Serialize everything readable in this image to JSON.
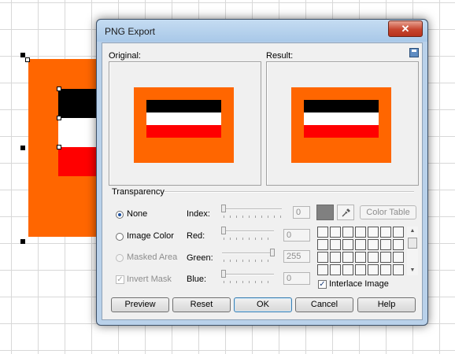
{
  "window": {
    "title": "PNG Export",
    "close_label": "✕"
  },
  "preview": {
    "original_label": "Original:",
    "result_label": "Result:"
  },
  "transparency": {
    "group_label": "Transparency",
    "options": {
      "none": "None",
      "image_color": "Image Color",
      "masked_area": "Masked Area",
      "invert_mask": "Invert Mask"
    },
    "selected": "None",
    "fields": {
      "index": {
        "label": "Index:",
        "value": "0"
      },
      "red": {
        "label": "Red:",
        "value": "0"
      },
      "green": {
        "label": "Green:",
        "value": "255"
      },
      "blue": {
        "label": "Blue:",
        "value": "0"
      }
    },
    "swatch_color": "#808080",
    "color_table_label": "Color Table",
    "interlace_label": "Interlace Image",
    "interlace_checked": true
  },
  "buttons": {
    "preview": "Preview",
    "reset": "Reset",
    "ok": "OK",
    "cancel": "Cancel",
    "help": "Help"
  },
  "flag_colors": [
    "#000000",
    "#ffffff",
    "#ff0000"
  ],
  "background_color": "#ff6600"
}
